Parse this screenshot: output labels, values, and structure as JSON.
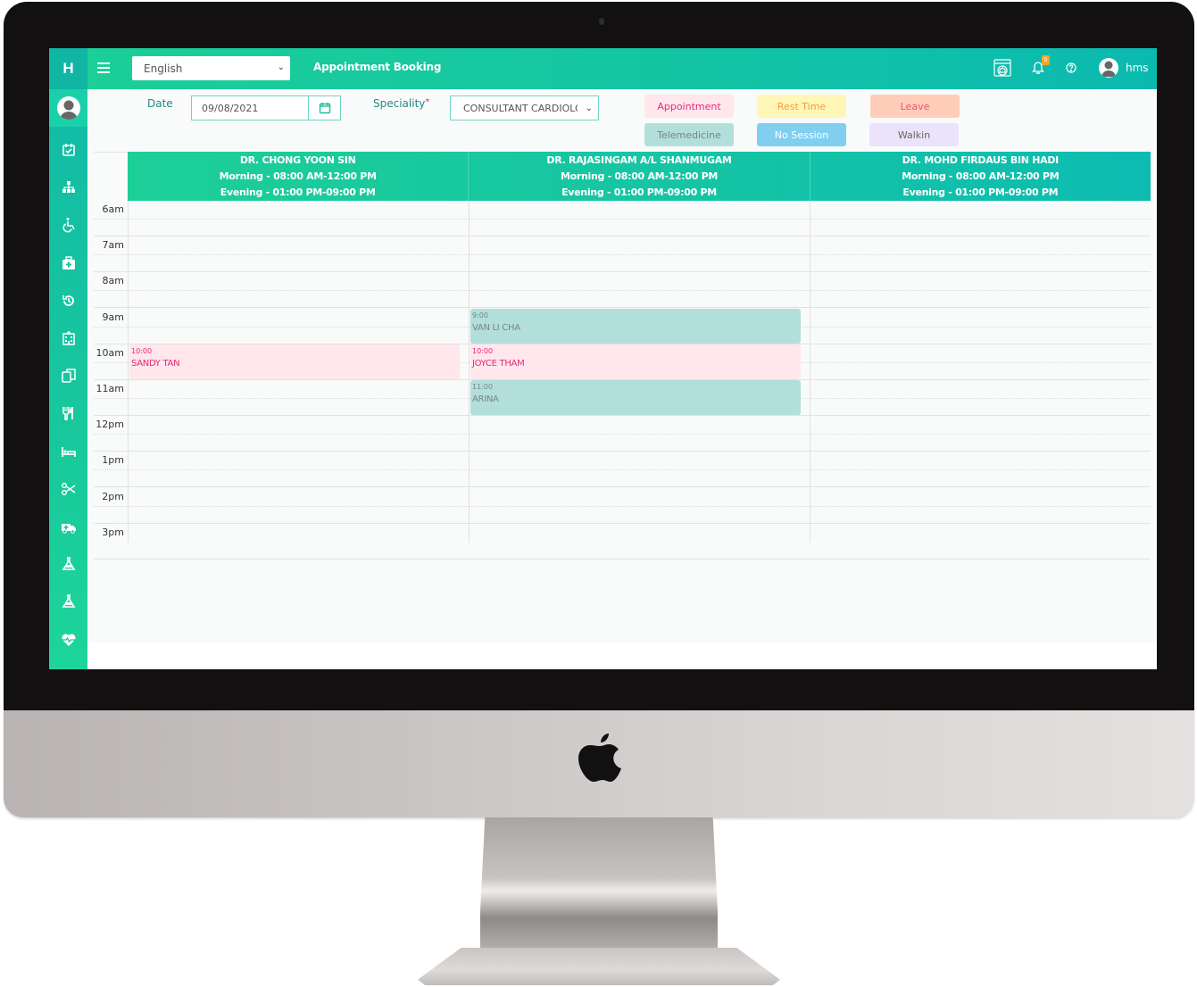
{
  "app": {
    "brand_letter": "H",
    "language": "English",
    "page_title": "Appointment Booking",
    "notifications_count": "0",
    "username": "hms",
    "colors": {
      "primary_start": "#1ccf97",
      "primary_end": "#0bb9b0",
      "badge": "#f5a623",
      "label_text": "#238b83"
    }
  },
  "sidebar": {
    "items": [
      {
        "icon": "calendar-check-icon"
      },
      {
        "icon": "sitemap-icon"
      },
      {
        "icon": "wheelchair-icon"
      },
      {
        "icon": "medical-kit-icon"
      },
      {
        "icon": "history-icon"
      },
      {
        "icon": "hospital-building-icon"
      },
      {
        "icon": "copy-documents-icon"
      },
      {
        "icon": "utensils-icon"
      },
      {
        "icon": "bed-icon"
      },
      {
        "icon": "scissors-icon"
      },
      {
        "icon": "ambulance-icon"
      },
      {
        "icon": "flask-icon"
      },
      {
        "icon": "flask-icon"
      },
      {
        "icon": "heartbeat-icon"
      },
      {
        "icon": "more-icon"
      }
    ]
  },
  "filters": {
    "date_label": "Date",
    "date_value": "09/08/2021",
    "speciality_label": "Speciality",
    "required_marker": "*",
    "speciality_value": "CONSULTANT CARDIOLOGIST"
  },
  "legend": [
    {
      "label": "Appointment",
      "bg": "#ffe7ec",
      "fg": "#e7277a"
    },
    {
      "label": "Rest Time",
      "bg": "#fff6b8",
      "fg": "#f39c3d"
    },
    {
      "label": "Leave",
      "bg": "#ffcdb8",
      "fg": "#e8597a"
    },
    {
      "label": "Telemedicine",
      "bg": "#b2dfdb",
      "fg": "#7a8585"
    },
    {
      "label": "No Session",
      "bg": "#81cff0",
      "fg": "#ffffff"
    },
    {
      "label": "Walkin",
      "bg": "#ebe3fb",
      "fg": "#666666"
    }
  ],
  "calendar": {
    "doctors": [
      {
        "name": "DR. CHONG YOON SIN",
        "morning": "Morning - 08:00 AM-12:00 PM",
        "evening": "Evening - 01:00 PM-09:00 PM"
      },
      {
        "name": "DR. RAJASINGAM A/L SHANMUGAM",
        "morning": "Morning - 08:00 AM-12:00 PM",
        "evening": "Evening - 01:00 PM-09:00 PM"
      },
      {
        "name": "DR. MOHD FIRDAUS BIN HADI",
        "morning": "Morning - 08:00 AM-12:00 PM",
        "evening": "Evening - 01:00 PM-09:00 PM"
      }
    ],
    "hours": [
      "6am",
      "7am",
      "8am",
      "9am",
      "10am",
      "11am",
      "12pm",
      "1pm",
      "2pm",
      "3pm"
    ],
    "appointments": [
      {
        "doctor": 0,
        "hour": "10am",
        "time": "10:00",
        "patient": "SANDY TAN",
        "type": "Appointment"
      },
      {
        "doctor": 1,
        "hour": "9am",
        "time": "9:00",
        "patient": "VAN LI CHA",
        "type": "Telemedicine"
      },
      {
        "doctor": 1,
        "hour": "10am",
        "time": "10:00",
        "patient": "JOYCE THAM",
        "type": "Appointment"
      },
      {
        "doctor": 1,
        "hour": "11am",
        "time": "11:00",
        "patient": "ARINA",
        "type": "Telemedicine"
      }
    ]
  }
}
